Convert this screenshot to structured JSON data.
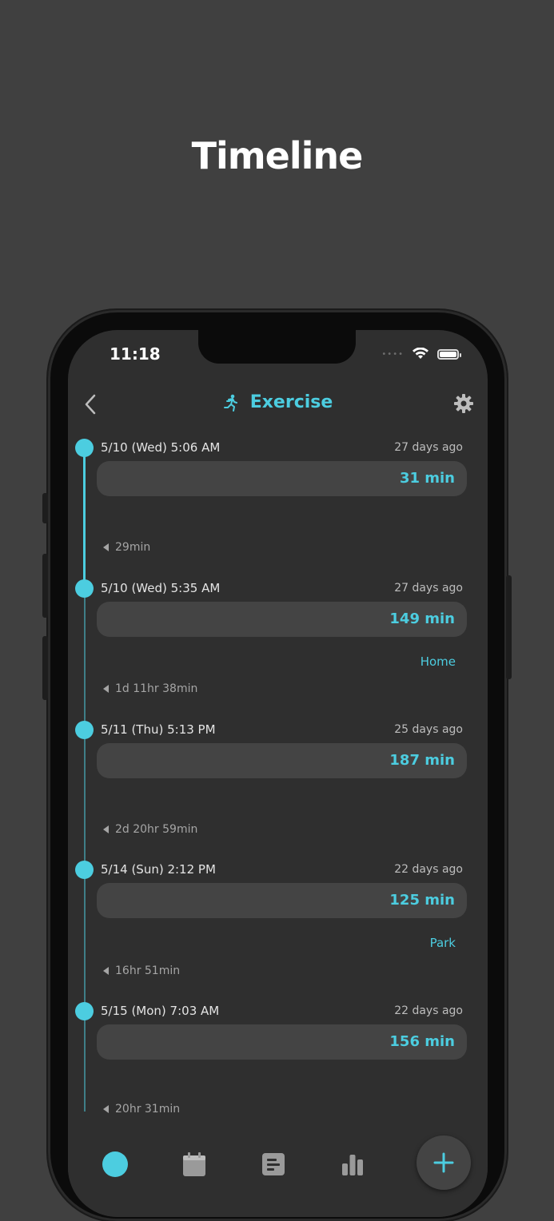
{
  "page_title": "Timeline",
  "status": {
    "time": "11:18"
  },
  "header": {
    "title": "Exercise",
    "back_icon": "chevron-left-icon",
    "title_icon": "running-person-icon",
    "settings_icon": "gear-icon"
  },
  "colors": {
    "accent": "#4ccde0",
    "background": "#2f2f2f",
    "card": "#444444"
  },
  "entries": [
    {
      "date": "5/10 (Wed)  5:06 AM",
      "ago": "27 days ago",
      "value": "31 min",
      "tag": ""
    },
    {
      "date": "5/10 (Wed)  5:35 AM",
      "ago": "27 days ago",
      "value": "149 min",
      "tag": "Home"
    },
    {
      "date": "5/11 (Thu)  5:13 PM",
      "ago": "25 days ago",
      "value": "187 min",
      "tag": ""
    },
    {
      "date": "5/14 (Sun)  2:12 PM",
      "ago": "22 days ago",
      "value": "125 min",
      "tag": "Park"
    },
    {
      "date": "5/15 (Mon)  7:03 AM",
      "ago": "22 days ago",
      "value": "156 min",
      "tag": ""
    }
  ],
  "gaps": [
    "29min",
    "1d 11hr 38min",
    "2d 20hr 59min",
    "16hr 51min",
    "20hr 31min"
  ],
  "tabs": [
    {
      "icon": "timeline-dot-icon"
    },
    {
      "icon": "calendar-icon"
    },
    {
      "icon": "notes-icon"
    },
    {
      "icon": "bar-chart-icon"
    }
  ],
  "add_button": {
    "icon": "plus-icon"
  }
}
